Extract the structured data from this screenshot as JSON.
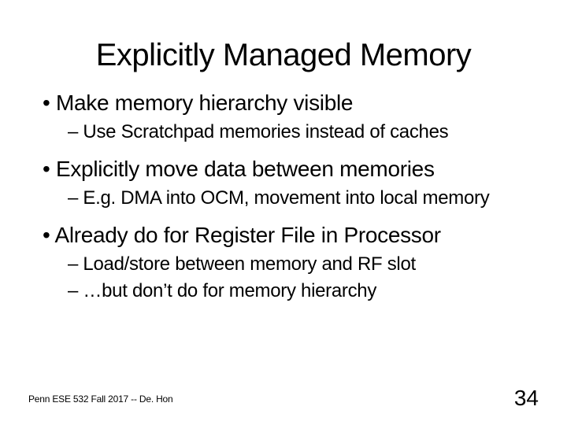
{
  "title": "Explicitly Managed Memory",
  "bullets": [
    {
      "text": "Make memory hierarchy visible",
      "sub": [
        "Use Scratchpad memories instead of caches"
      ]
    },
    {
      "text": "Explicitly move data between memories",
      "sub": [
        "E.g. DMA into OCM, movement into local memory"
      ]
    },
    {
      "text": "Already do for Register File in Processor",
      "sub": [
        "Load/store between memory and RF slot",
        "…but don’t do for memory hierarchy"
      ]
    }
  ],
  "footer": {
    "left": "Penn ESE 532 Fall 2017 -- De. Hon",
    "right": "34"
  }
}
